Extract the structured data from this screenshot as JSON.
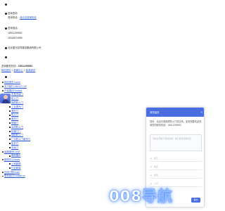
{
  "contact": {
    "consult_label": "咨询咨询",
    "consult_line_text": "咨询热线：",
    "consult_line_link": "请点击咨询热线",
    "phone_title": "咨询电话：",
    "phone_1": "18911259552",
    "phone_2": "18315674680",
    "company": "北京国元宏祥建设集团有限公司",
    "hotline_label": "咨询服务热线：",
    "hotline_number": "18911259552"
  },
  "breadcrumb": {
    "home": "网站首页",
    "sep1": "»",
    "level2": "新闻中心",
    "sep2": "»",
    "current": "新闻资讯"
  },
  "nav": {
    "items": [
      {
        "label": "网站首页 home",
        "sub": false
      },
      {
        "label": "关于我们 ABOUT US",
        "sub": false
      },
      {
        "label": "产品展示Product",
        "sub": false
      },
      {
        "label": "东莞专用门",
        "sub": true
      },
      {
        "label": "防火门",
        "sub": true
      },
      {
        "label": "钢质防火门",
        "sub": true
      },
      {
        "label": "工业提升门",
        "sub": true
      },
      {
        "label": "滑升门",
        "sub": true
      },
      {
        "label": "防火门",
        "sub": true
      },
      {
        "label": "卷帘门",
        "sub": true
      },
      {
        "label": "快速门",
        "sub": true
      },
      {
        "label": "木质防火门",
        "sub": true
      },
      {
        "label": "防爆门门",
        "sub": true
      },
      {
        "label": "钢制防火门",
        "sub": true
      },
      {
        "label": "广州防火门卷帘门",
        "sub": true
      },
      {
        "label": "防护门",
        "sub": true
      },
      {
        "label": "车库门",
        "sub": true
      },
      {
        "label": "经典案例CASE",
        "sub": false
      },
      {
        "label": "案例展示",
        "sub": true
      },
      {
        "label": "新闻中心News",
        "sub": false
      },
      {
        "label": "公司新闻",
        "sub": true
      },
      {
        "label": "行业新闻",
        "sub": true
      },
      {
        "label": "在线订购Order",
        "sub": false
      },
      {
        "label": "联系我们Contact us",
        "sub": false
      }
    ]
  },
  "chat": {
    "title": "请您留言",
    "close": "×",
    "message": "您好，欢迎光临钢质防火门供应商，如有需要欢迎咨询您的服务热线：18911259552",
    "input_placeholder": "请在这里留下您的需求，我们会尽快联系您",
    "field_name": "姓名",
    "field_phone": "电话",
    "field_email": "邮箱",
    "field_company": "公司",
    "send": "提交"
  },
  "watermark": {
    "text": "008导航"
  },
  "colors": {
    "link": "#2a55d3",
    "chat_header": "#4a6ee0",
    "watermark_glow": "#2878ff"
  }
}
